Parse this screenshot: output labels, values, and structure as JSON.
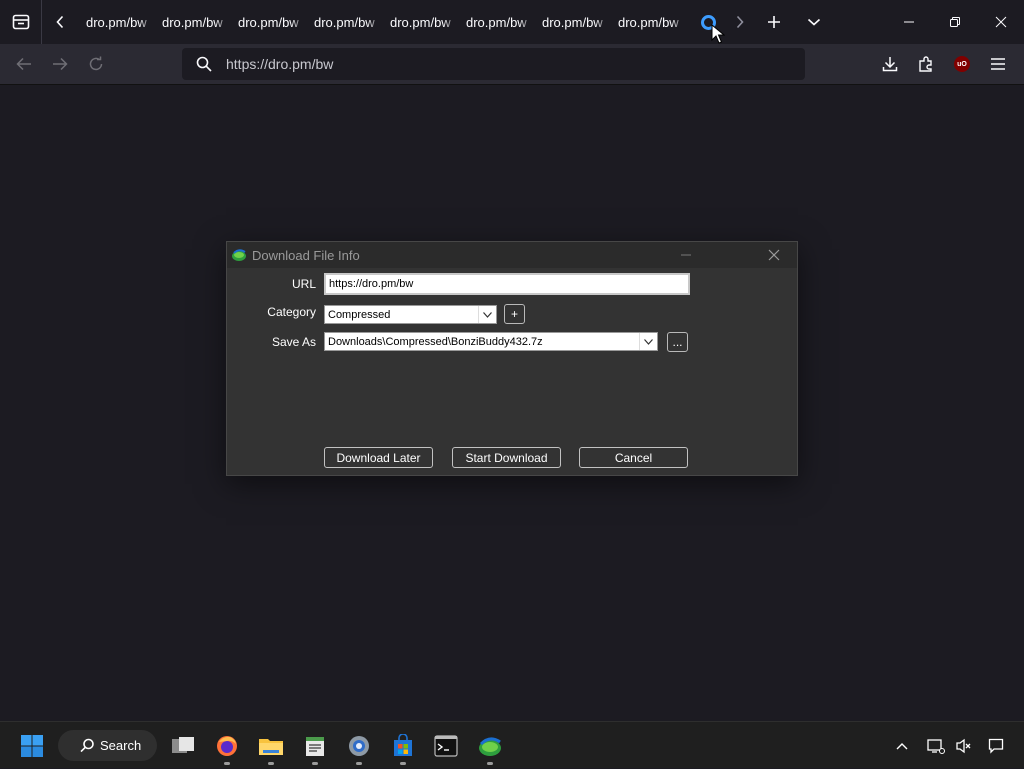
{
  "browser": {
    "tabs": [
      {
        "title": "dro.pm/bw"
      },
      {
        "title": "dro.pm/bw"
      },
      {
        "title": "dro.pm/bw"
      },
      {
        "title": "dro.pm/bw"
      },
      {
        "title": "dro.pm/bw"
      },
      {
        "title": "dro.pm/bw"
      },
      {
        "title": "dro.pm/bw"
      },
      {
        "title": "dro.pm/bw"
      }
    ],
    "address": "https://dro.pm/bw",
    "extension_badge": "uO",
    "colors": {
      "loading": "#3d9dff",
      "toolbar": "#2b2a33",
      "background": "#1c1b22"
    }
  },
  "dialog": {
    "title": "Download File Info",
    "url_label": "URL",
    "url_value": "https://dro.pm/bw",
    "category_label": "Category",
    "category_value": "Compressed",
    "add_category": "+",
    "save_as_label": "Save As",
    "save_as_value": "Downloads\\Compressed\\BonziBuddy432.7z",
    "browse": "...",
    "buttons": {
      "later": "Download Later",
      "start": "Start Download",
      "cancel": "Cancel"
    }
  },
  "taskbar": {
    "search_label": "Search",
    "apps": [
      "start-icon",
      "task-view-icon",
      "firefox-icon",
      "file-explorer-icon",
      "notepad-icon",
      "settings-icon",
      "store-icon",
      "terminal-icon",
      "idm-icon"
    ]
  }
}
